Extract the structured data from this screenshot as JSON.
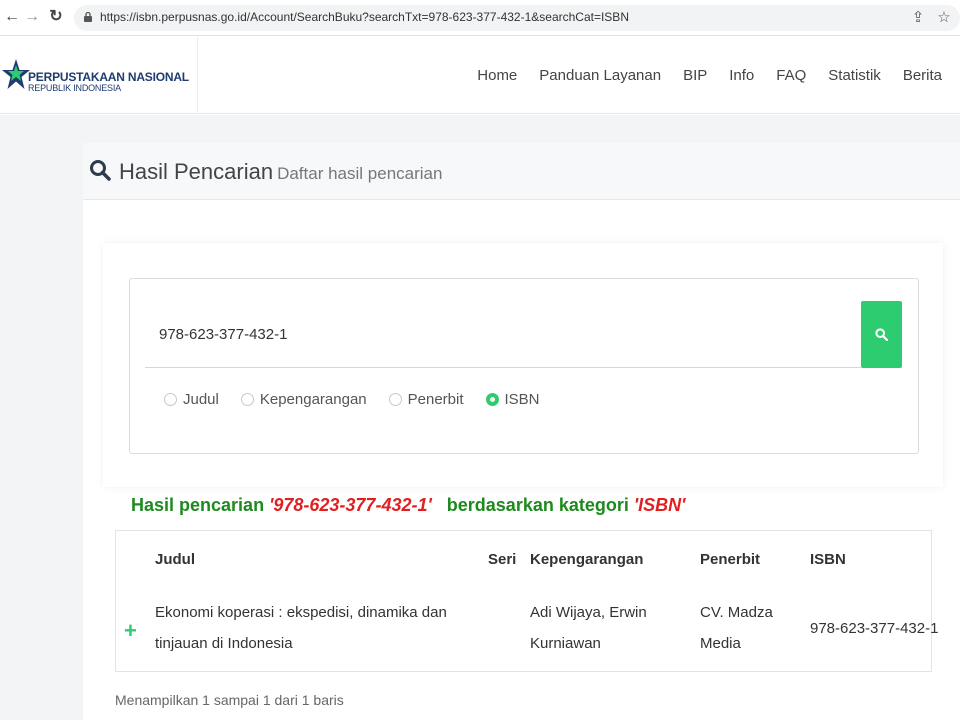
{
  "browser": {
    "url": "https://isbn.perpusnas.go.id/Account/SearchBuku?searchTxt=978-623-377-432-1&searchCat=ISBN",
    "back_glyph": "←",
    "forward_glyph": "→",
    "reload_glyph": "↻",
    "share_glyph": "⇪",
    "star_glyph": "☆"
  },
  "logo": {
    "title": "PERPUSTAKAAN NASIONAL",
    "subtitle": "REPUBLIK INDONESIA"
  },
  "nav": {
    "items": [
      {
        "label": "Home"
      },
      {
        "label": "Panduan Layanan"
      },
      {
        "label": "BIP"
      },
      {
        "label": "Info"
      },
      {
        "label": "FAQ"
      },
      {
        "label": "Statistik"
      },
      {
        "label": "Berita"
      }
    ]
  },
  "panel": {
    "title": "Hasil Pencarian",
    "subtitle": "Daftar hasil pencarian"
  },
  "search": {
    "value": "978-623-377-432-1",
    "categories": [
      {
        "label": "Judul",
        "selected": false
      },
      {
        "label": "Kepengarangan",
        "selected": false
      },
      {
        "label": "Penerbit",
        "selected": false
      },
      {
        "label": "ISBN",
        "selected": true
      }
    ]
  },
  "result": {
    "prefix": "Hasil pencarian",
    "query": "'978-623-377-432-1'",
    "middle": "berdasarkan kategori",
    "category": "'ISBN'"
  },
  "table": {
    "headers": {
      "judul": "Judul",
      "seri": "Seri",
      "kepengarangan": "Kepengarangan",
      "penerbit": "Penerbit",
      "isbn": "ISBN"
    },
    "rows": [
      {
        "expand": "+",
        "judul": "Ekonomi koperasi : ekspedisi, dinamika dan tinjauan di Indonesia",
        "seri": "",
        "kepengarangan": "Adi Wijaya, Erwin Kurniawan",
        "penerbit": "CV. Madza Media",
        "isbn": "978-623-377-432-1"
      }
    ]
  },
  "footer": {
    "summary": "Menampilkan 1 sampai 1 dari 1 baris"
  },
  "colors": {
    "accent": "#2ecc71",
    "result_green": "#1e8a1e",
    "result_red": "#e02020",
    "logo_blue": "#1f3c6e"
  },
  "icons": {
    "lock": "lock-icon",
    "search": "search-icon",
    "logo": "star-logo-icon",
    "expand": "plus-icon"
  }
}
